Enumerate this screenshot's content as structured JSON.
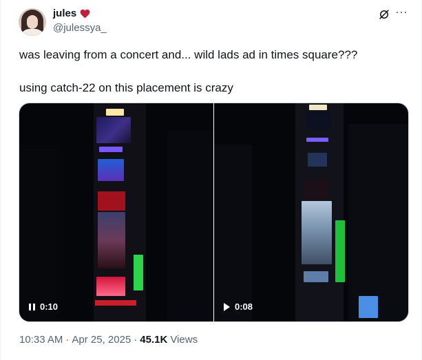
{
  "author": {
    "display_name": "jules",
    "handle": "@julessya_",
    "badge_icon": "heart-icon",
    "badge_color": "#c0203a"
  },
  "tweet": {
    "line1": "was leaving from a concert and... wild lads ad in times square???",
    "line2": "using catch-22 on this placement is crazy"
  },
  "media": {
    "videos": [
      {
        "time": "0:10",
        "state_icon": "pause-icon"
      },
      {
        "time": "0:08",
        "state_icon": "play-icon"
      }
    ]
  },
  "meta": {
    "timestamp": "10:33 AM",
    "separator1": "·",
    "date": "Apr 25, 2025",
    "separator2": "·",
    "views_count": "45.1K",
    "views_label": "Views"
  },
  "colors": {
    "text_primary": "#0f1419",
    "text_secondary": "#536471",
    "border": "#cfd9de"
  },
  "icons": [
    "grok-icon",
    "more-icon"
  ]
}
